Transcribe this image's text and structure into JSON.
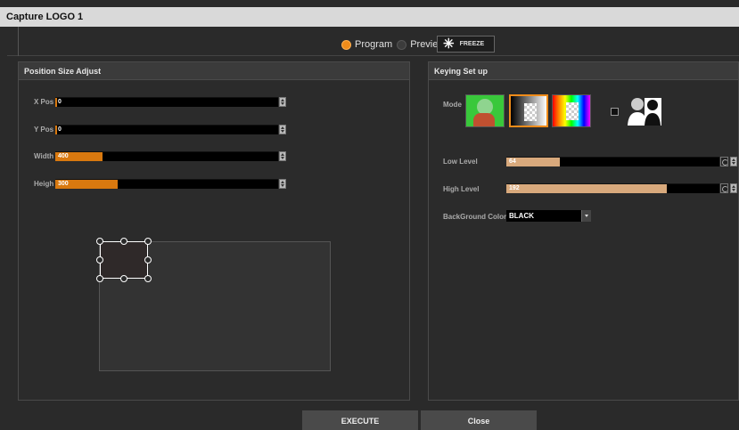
{
  "window": {
    "title": "Capture LOGO 1"
  },
  "source": {
    "options": [
      {
        "label": "Program",
        "selected": true
      },
      {
        "label": "Preview",
        "selected": false
      }
    ],
    "freeze_label": "FREEZE"
  },
  "position_panel": {
    "title": "Position Size Adjust",
    "fields": [
      {
        "label": "X Pos",
        "value": "0"
      },
      {
        "label": "Y Pos",
        "value": "0"
      },
      {
        "label": "Width",
        "value": "400"
      },
      {
        "label": "Heigh",
        "value": "300"
      }
    ]
  },
  "keying_panel": {
    "title": "Keying Set up",
    "mode_label": "Mode",
    "modes": [
      "chroma-key",
      "luma-key",
      "color-key"
    ],
    "selected_mode": "luma-key",
    "low_level": {
      "label": "Low Level",
      "value": "64",
      "fraction": 0.25
    },
    "high_level": {
      "label": "High Level",
      "value": "192",
      "fraction": 0.75
    },
    "background_color": {
      "label": "BackGround Color",
      "value": "BLACK"
    }
  },
  "footer": {
    "execute_label": "EXECUTE",
    "close_label": "Close"
  },
  "colors": {
    "accent": "#f08c1a",
    "level_fill": "#d8a97c",
    "slider_fill": "#d9790f"
  }
}
